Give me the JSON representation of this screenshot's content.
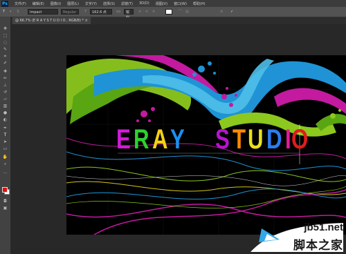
{
  "app": {
    "logo": "Ps"
  },
  "menu": [
    "文件(F)",
    "编辑(E)",
    "图像(I)",
    "图层(L)",
    "文字(Y)",
    "选择(S)",
    "滤镜(T)",
    "3D(D)",
    "视图(V)",
    "窗口(W)",
    "帮助(H)"
  ],
  "options": {
    "tool_glyph": "T",
    "font_family": "Impact",
    "font_style": "Regular",
    "font_size": "162.6 点",
    "aa_label": "aa",
    "aa_mode": "锐利"
  },
  "document": {
    "tab_label": "@ 66.7% (E R A Y        S T U D I O , RGB/8) *"
  },
  "canvas_content": {
    "word1": [
      "E",
      "R",
      "A",
      "Y"
    ],
    "word2": [
      "S",
      "T",
      "U",
      "D",
      "I",
      "O"
    ],
    "word1_colors": [
      "#d21bd6",
      "#2ed12e",
      "#f6d014",
      "#1b8ff0"
    ],
    "word2_colors": [
      "#b613d0",
      "#ff8a00",
      "#e9e11b",
      "#2b7cf0",
      "#e11b9b",
      "#e01c1c"
    ]
  },
  "watermark": {
    "site": "jb51.net",
    "chinese": "脚本之家"
  },
  "colors": {
    "foreground": "#e01010",
    "background": "#ffffff"
  }
}
